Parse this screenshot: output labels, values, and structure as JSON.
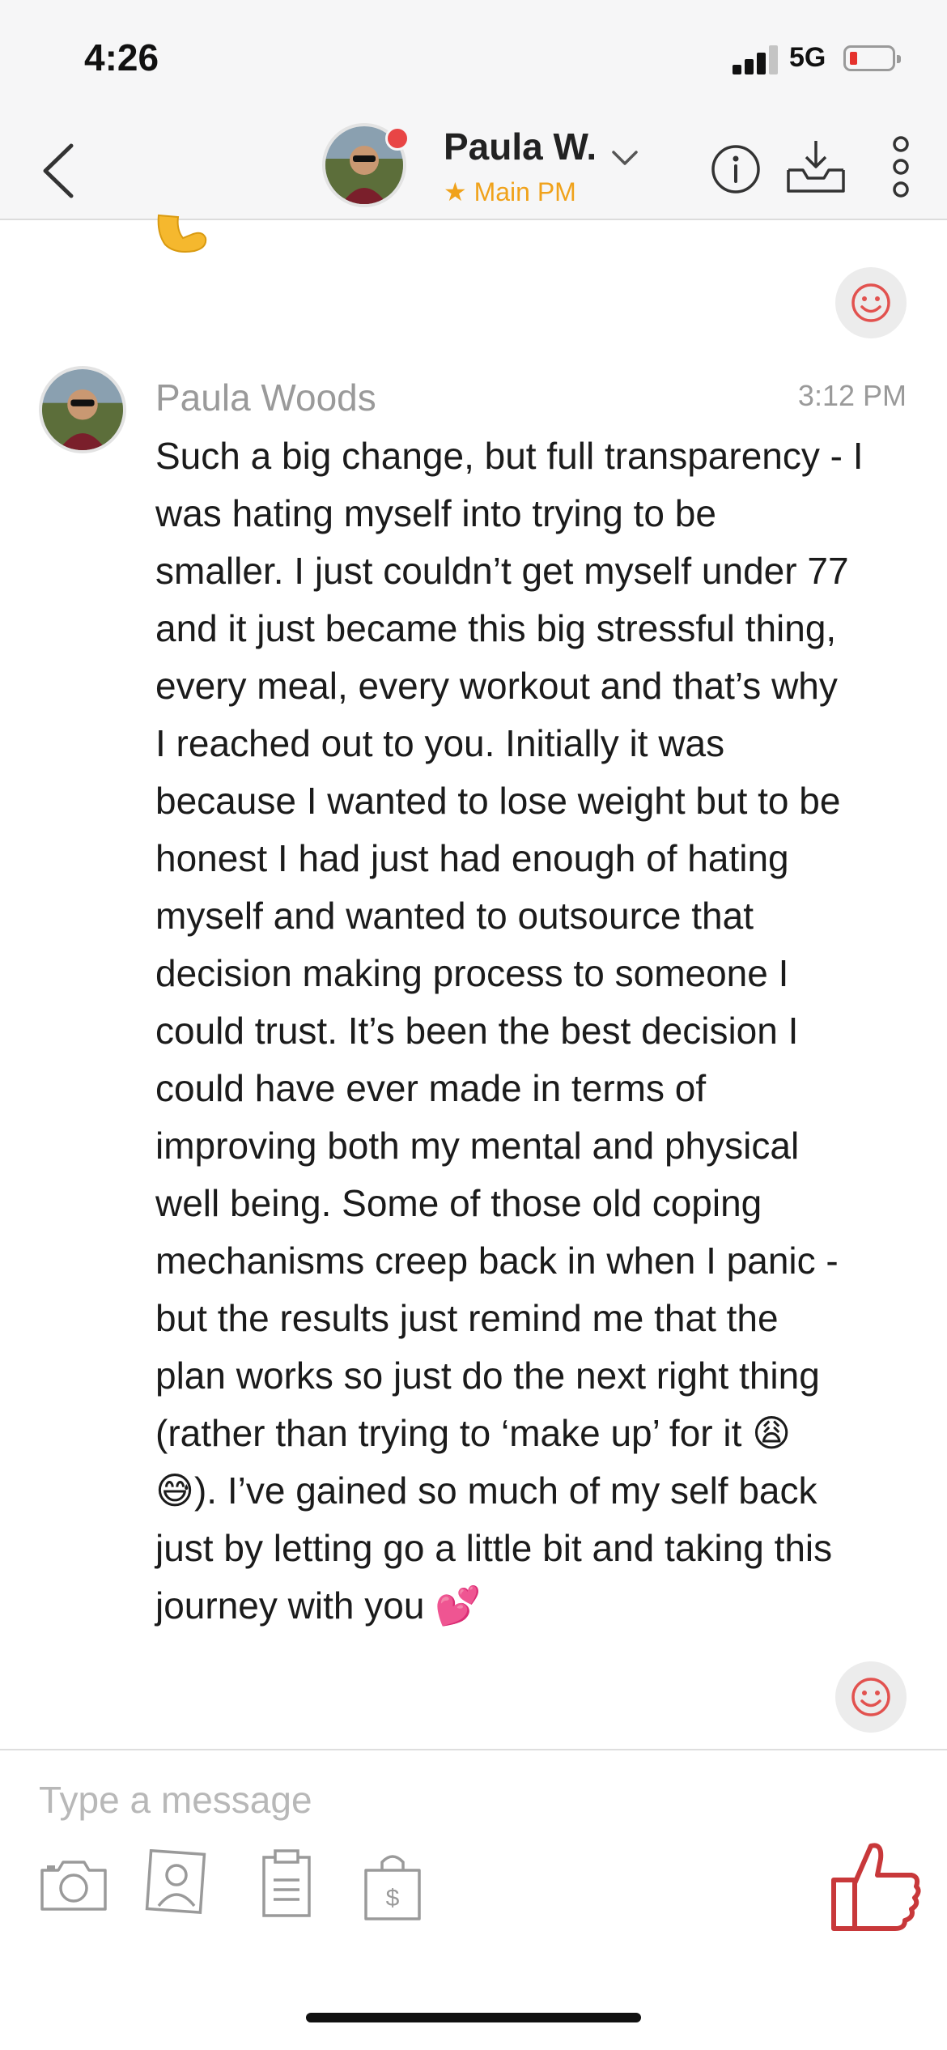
{
  "status_bar": {
    "time": "4:26",
    "network": "5G",
    "battery_level": 0.12,
    "battery_color": "#e5322d"
  },
  "header": {
    "contact_name": "Paula W.",
    "subtitle": "Main PM",
    "subtitle_icon": "star-icon",
    "accent_color": "#f0a21b",
    "online_dot_color": "#e84545"
  },
  "message": {
    "sender": "Paula Woods",
    "time": "3:12 PM",
    "text": "Such a big change, but full transparency - I\nwas hating myself into trying to be\nsmaller. I just couldn’t get myself under 77\nand it just became this big stressful thing,\nevery meal, every workout and that’s why\nI reached out to you. Initially it was\nbecause I wanted to lose weight but to be\nhonest I had just had enough of hating\nmyself and wanted to outsource that\ndecision making process to someone I\ncould trust. It’s been the best decision I\ncould have ever made in terms of\nimproving both my mental and physical\nwell being. Some of those old coping\nmechanisms creep back in when I panic -\nbut the results just remind me that the\nplan works so just do the next right thing\n(rather than trying to ‘make up’ for it 😩\n😅). I’ve gained so much of my self back\njust by letting go a little bit and taking this\njourney with you 💕"
  },
  "composer": {
    "placeholder": "Type a message",
    "reaction_color": "#e2524f",
    "like_color": "#c8383a"
  }
}
